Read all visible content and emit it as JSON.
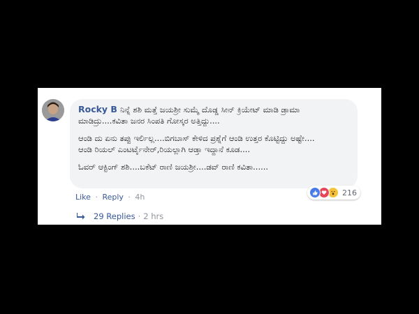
{
  "comment": {
    "author": "Rocky B",
    "lines": [
      "ನಿನ್ನೆ ಶಶಿ ಮತ್ತೆ ಜಯಶ್ರೀ ಸುಮ್ಮೆ ದೊಡ್ಡ ಸೀನ್ ಕ್ರಿಯೇಟ್ ಮಾಡಿ ಡ್ರಾಮಾ ಮಾಡಿದ್ರು....ಕವಿತಾ ಜನರ ಸಿಂಪತಿ ಗೋಸ್ಕರ ಅತ್ತಿದ್ದು....",
      "ಆಂಡಿ ದು ಏನು ತಪ್ಪು ಇರ್ಲಿಲ್ಲ....ಬಿಗಬಾಸ್ ಕೇಳಿದ ಪ್ರಶ್ನೆಗೆ ಆಂಡಿ ಉತ್ತರ ಕೊಟ್ಟಿದ್ದು ಅಷ್ಟೇ....",
      "ಆಂಡಿ ರಿಯಲ್ ಎಂಟರ್ಟೈನೇರ್,ರಿಯಲ್ಲಾಗಿ ಆಡ್ತಾ ಇದ್ದಾನೆ ಕೂಡ....",
      "ಓವರ್ ಆಕ್ಟಿಂಗ್ ಶಶಿ....ಬಕೆಟ್ ರಾಣಿ ಜಯಶ್ರೀ....ಡವ್ ರಾಣಿ ಕವಿತಾ......"
    ]
  },
  "reactions": {
    "icons": [
      "like-icon",
      "love-icon",
      "wow-icon"
    ],
    "count": "216"
  },
  "actions": {
    "like": "Like",
    "separator": "·",
    "reply": "Reply",
    "time": "4h"
  },
  "replies": {
    "label": "29 Replies",
    "separator": "·",
    "time": "2 hrs"
  },
  "colors": {
    "link": "#385898",
    "muted": "#90949c",
    "bubble": "#f2f3f5",
    "like": "#4a7ae8",
    "love": "#e8455a",
    "wow": "#f5c33b"
  }
}
